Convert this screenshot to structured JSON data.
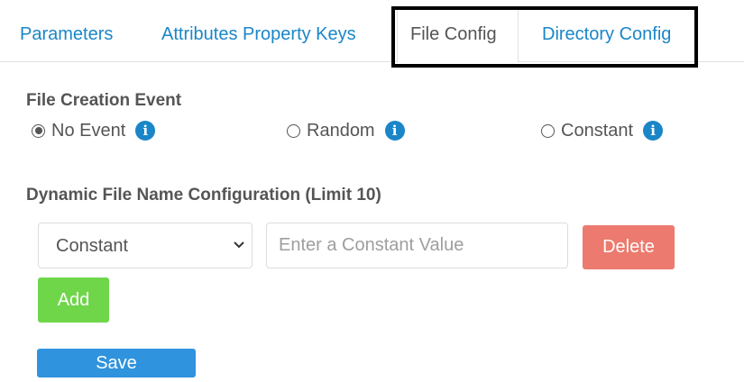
{
  "tabs": {
    "parameters": "Parameters",
    "attributes": "Attributes Property Keys",
    "file_config": "File Config",
    "directory_config": "Directory Config",
    "active": "File Config"
  },
  "file_creation_event": {
    "title": "File Creation Event",
    "options": [
      {
        "label": "No Event",
        "checked": true,
        "icon": "info-icon"
      },
      {
        "label": "Random",
        "checked": false,
        "icon": "info-icon"
      },
      {
        "label": "Constant",
        "checked": false,
        "icon": "info-icon"
      }
    ],
    "info_glyph": "i"
  },
  "dynamic_name": {
    "title": "Dynamic File Name Configuration (Limit 10)",
    "select_value": "Constant",
    "input_value": "",
    "input_placeholder": "Enter a Constant Value",
    "delete_label": "Delete",
    "add_label": "Add"
  },
  "save_label": "Save",
  "colors": {
    "link": "#1a86c8",
    "text": "#555555",
    "delete": "#ec7a6e",
    "add": "#6fd64a",
    "save": "#2f93dd"
  }
}
